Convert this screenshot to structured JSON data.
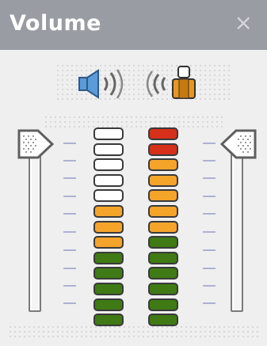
{
  "window": {
    "title": "Volume",
    "close_glyph": "×"
  },
  "icons": {
    "speaker": "speaker-icon",
    "microphone_user": "microphone-user-icon"
  },
  "output": {
    "level": 0.4,
    "slider_level": 1.0,
    "segments": [
      "white",
      "white",
      "white",
      "white",
      "white",
      "orange",
      "orange",
      "orange",
      "green",
      "green",
      "green",
      "green",
      "green"
    ]
  },
  "input": {
    "level": 1.0,
    "slider_level": 1.0,
    "segments": [
      "red",
      "red",
      "orange",
      "orange",
      "orange",
      "orange",
      "orange",
      "green",
      "green",
      "green",
      "green",
      "green",
      "green"
    ]
  },
  "colors": {
    "title_bar": "#9a9ca4",
    "white": "#ffffff",
    "orange": "#f5a42a",
    "green": "#3f7a14",
    "red": "#d7301a",
    "tick": "#aeb2d0"
  }
}
